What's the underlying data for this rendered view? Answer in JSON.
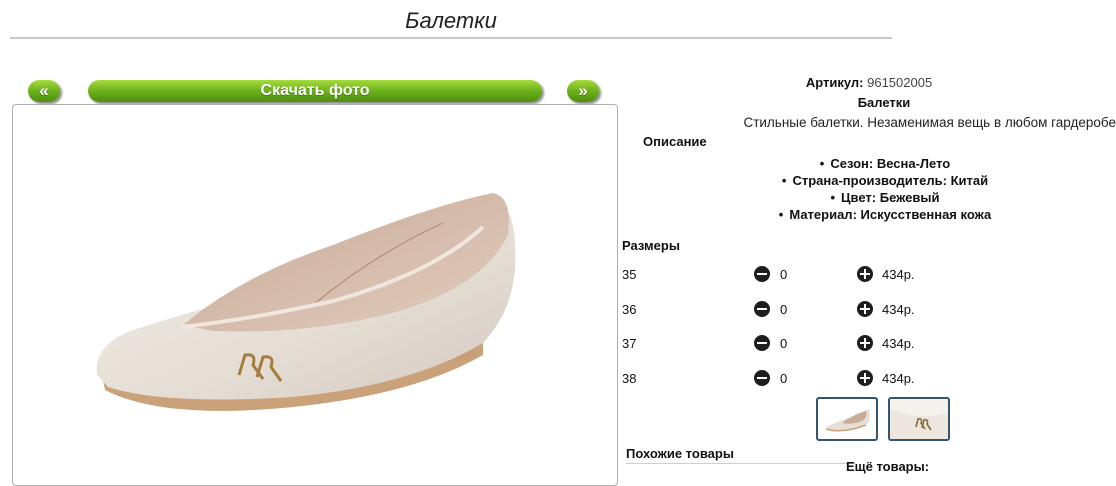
{
  "page": {
    "title": "Балетки"
  },
  "gallery": {
    "prev_label": "«",
    "download_label": "Скачать фото",
    "next_label": "»"
  },
  "product": {
    "article_label": "Артикул:",
    "article_value": "961502005",
    "name": "Балетки",
    "description": "Стильные балетки. Незаменимая вещь в любом гардеробе",
    "description_heading": "Описание",
    "specs": [
      "Сезон: Весна-Лето",
      "Страна-производитель: Китай",
      "Цвет: Бежевый",
      "Материал: Искусственная кожа"
    ]
  },
  "sizes": {
    "heading": "Размеры",
    "rows": [
      {
        "size": "35",
        "qty": "0",
        "price": "434р."
      },
      {
        "size": "36",
        "qty": "0",
        "price": "434р."
      },
      {
        "size": "37",
        "qty": "0",
        "price": "434р."
      },
      {
        "size": "38",
        "qty": "0",
        "price": "434р."
      }
    ]
  },
  "related": {
    "similar_label": "Похожие товары",
    "more_label": "Ещё товары:"
  },
  "icons": {
    "minus": "minus-circle-icon",
    "plus": "plus-circle-icon"
  },
  "colors": {
    "button_green": "#6cb11c",
    "thumb_border": "#33556f"
  }
}
